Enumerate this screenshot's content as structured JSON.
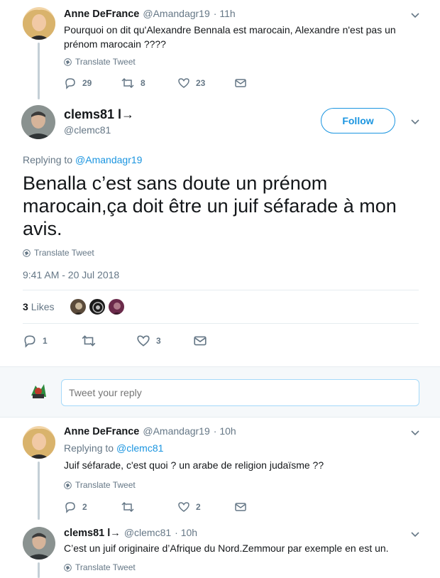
{
  "tweet1": {
    "name": "Anne DeFrance",
    "handle": "@Amandagr19",
    "time": "· 11h",
    "text_line1": "Pourquoi on dit qu'Alexandre Bennala  est marocain, Alexandre n'est pas un",
    "text_line2": "prénom marocain ????",
    "translate": "Translate Tweet",
    "replies": "29",
    "retweets": "8",
    "likes": "23"
  },
  "main_tweet": {
    "name": "clems81 l→",
    "handle": "@clemc81",
    "follow": "Follow",
    "replying_prefix": "Replying to",
    "replying_to": "@Amandagr19",
    "text_line1": "Benalla c’est sans doute un prénom",
    "text_line2": "marocain,ça doit être un juif séfarade à mon",
    "text_line3": "avis.",
    "translate": "Translate Tweet",
    "timestamp": "9:41 AM - 20 Jul 2018",
    "likes_count": "3",
    "likes_label": "Likes",
    "replies": "1",
    "retweets": "",
    "likes": "3"
  },
  "reply_box": {
    "placeholder": "Tweet your reply"
  },
  "tweet3": {
    "name": "Anne DeFrance",
    "handle": "@Amandagr19",
    "time": "· 10h",
    "replying_prefix": "Replying to",
    "replying_to": "@clemc81",
    "text": "Juif séfarade, c'est quoi ? un arabe de religion judaïsme ??",
    "translate": "Translate Tweet",
    "replies": "2",
    "likes": "2"
  },
  "tweet4": {
    "name": "clems81 l→",
    "handle": "@clemc81",
    "time": "· 10h",
    "text": "C’est un juif originaire d’Afrique du Nord.Zemmour par exemple en est un.",
    "translate": "Translate Tweet"
  },
  "colors": {
    "accent": "#1b95e0",
    "muted": "#657786",
    "separator": "#e6ecf0",
    "like_avatar_1": "#5a4a3a",
    "like_avatar_2": "#1a1a1a",
    "like_avatar_3": "#6b2a4a"
  },
  "icons": [
    "chevron-down-icon",
    "reply-icon",
    "retweet-icon",
    "heart-icon",
    "dm-icon",
    "globe-icon"
  ]
}
